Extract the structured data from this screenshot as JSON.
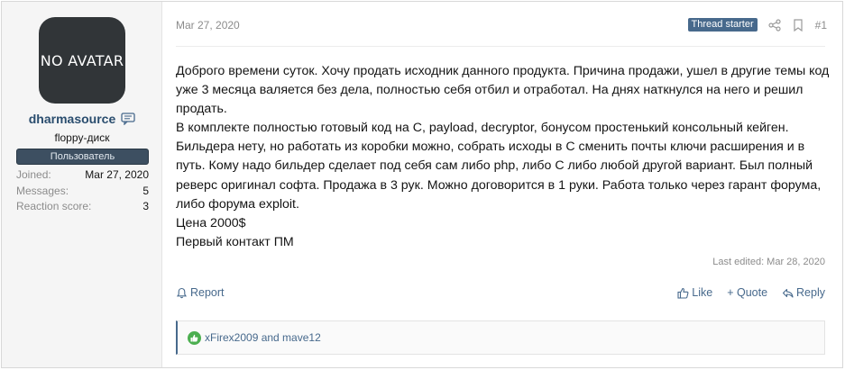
{
  "user": {
    "avatar_text": "NO AVATAR",
    "username": "dharmasource",
    "title": "floppy-диск",
    "banner": "Пользователь",
    "stats": [
      {
        "label": "Joined:",
        "value": "Mar 27, 2020"
      },
      {
        "label": "Messages:",
        "value": "5"
      },
      {
        "label": "Reaction score:",
        "value": "3"
      }
    ]
  },
  "post": {
    "date": "Mar 27, 2020",
    "badge": "Thread starter",
    "number": "#1",
    "paragraphs": [
      "Доброго времени суток. Хочу продать исходник данного продукта. Причина продажи, ушел в другие темы код уже 3 месяца валяется без дела, полностью себя отбил и отработал. На днях наткнулся на него и решил продать.",
      "В комплекте полностью готовый код на C, payload, decryptor, бонусом простенький консольный кейген. Бильдера нету, но работать из коробки можно, собрать исходы в C сменить почты ключи расширения и в путь. Кому надо бильдер сделает под себя сам либо php, либо C либо любой другой вариант. Был полный реверс оригинал софта. Продажа в 3 рук. Можно договорится в 1 руки. Работа только через гарант форума, либо форума exploit.",
      "Цена 2000$",
      "Первый контакт ПМ"
    ],
    "last_edited": "Last edited: Mar 28, 2020"
  },
  "actions": {
    "report": "Report",
    "like": "Like",
    "quote": "+ Quote",
    "reply": "Reply"
  },
  "reactions": {
    "text": "xFirex2009 and mave12"
  },
  "colors": {
    "link": "#47698c",
    "banner_bg": "#3d4f61",
    "avatar_bg": "#313538"
  }
}
